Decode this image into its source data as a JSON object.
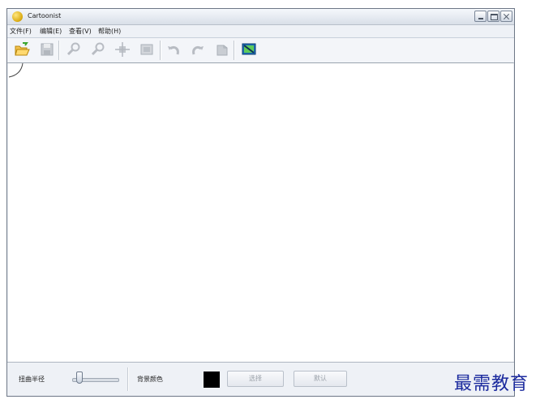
{
  "window": {
    "title": "Cartoonist"
  },
  "menu": {
    "items": [
      "文件(F)",
      "编辑(E)",
      "查看(V)",
      "帮助(H)"
    ]
  },
  "toolbar": {
    "tools": [
      {
        "name": "open-icon",
        "enabled": true
      },
      {
        "name": "save-icon",
        "enabled": false
      },
      {
        "name": "zoom-in-icon",
        "enabled": false
      },
      {
        "name": "zoom-out-icon",
        "enabled": false
      },
      {
        "name": "move-icon",
        "enabled": false
      },
      {
        "name": "fit-icon",
        "enabled": false
      },
      {
        "name": "undo-icon",
        "enabled": false
      },
      {
        "name": "redo-icon",
        "enabled": false
      },
      {
        "name": "history-icon",
        "enabled": false
      },
      {
        "name": "export-image-icon",
        "enabled": true
      }
    ]
  },
  "status": {
    "warp_radius_label": "扭曲半径",
    "bg_color_label": "背景颜色",
    "bg_color": "#000000",
    "select_button": "选择",
    "default_button": "默认"
  },
  "watermark": "最需教育",
  "colors": {
    "window_border": "#6d7786",
    "chrome_bg": "#eef1f6",
    "watermark": "#1b2a9e"
  }
}
